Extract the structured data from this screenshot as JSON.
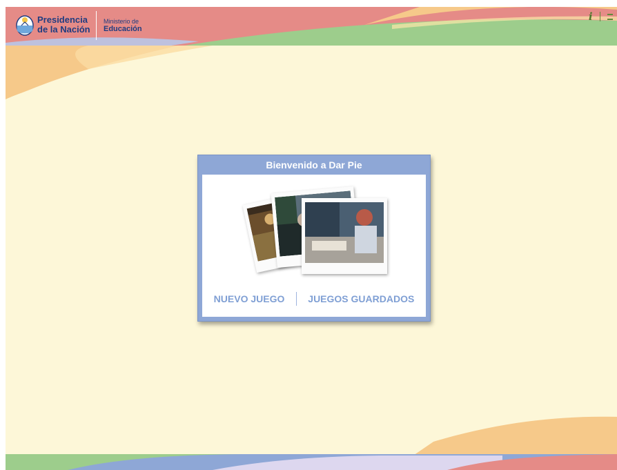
{
  "header": {
    "presidencia_line1": "Presidencia",
    "presidencia_line2": "de la Nación",
    "ministerio_line1": "Ministerio de",
    "ministerio_line2": "Educación"
  },
  "toolbar": {
    "info_icon": "info-icon",
    "menu_icon": "menu-icon",
    "info_glyph": "i"
  },
  "dialog": {
    "title": "Bienvenido a Dar Pie",
    "new_game_label": "NUEVO JUEGO",
    "saved_games_label": "JUEGOS GUARDADOS"
  },
  "colors": {
    "background": "#fdf7d8",
    "header_red": "#e58b87",
    "header_green": "#9dcd8c",
    "accent_orange": "#f6c98a",
    "dialog_blue": "#8ea7d6",
    "link_blue": "#7f9fd4"
  }
}
